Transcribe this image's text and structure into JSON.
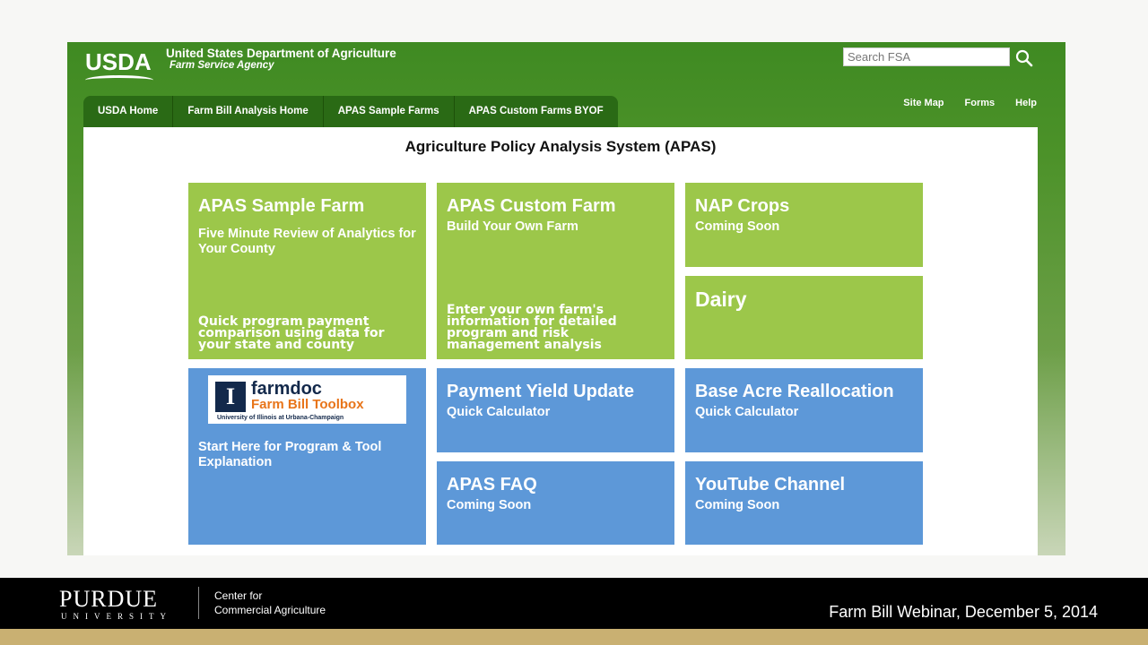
{
  "usda": {
    "logo": "USDA",
    "department": "United States Department of Agriculture",
    "agency": "Farm Service Agency",
    "search_placeholder": "Search FSA"
  },
  "nav": [
    "USDA Home",
    "Farm Bill Analysis Home",
    "APAS Sample Farms",
    "APAS Custom Farms BYOF"
  ],
  "util_links": [
    "Site Map",
    "Forms",
    "Help"
  ],
  "page_title": "Agriculture Policy Analysis System (APAS)",
  "tiles": {
    "sample_farm": {
      "title": "APAS Sample Farm",
      "subtitle": "Five Minute Review of Analytics for Your County",
      "description": "Quick program payment comparison using data for your state and county"
    },
    "custom_farm": {
      "title": "APAS Custom Farm",
      "subtitle": "Build Your Own Farm",
      "description": "Enter your own farm's information for detailed program and risk management analysis"
    },
    "nap_crops": {
      "title": "NAP Crops",
      "subtitle": "Coming Soon"
    },
    "dairy": {
      "title": "Dairy"
    },
    "farmdoc": {
      "logo_word": "farmdoc",
      "logo_tool": "Farm Bill Toolbox",
      "logo_university": "University of Illinois at Urbana-Champaign",
      "text": "Start Here for Program & Tool Explanation"
    },
    "payment_yield": {
      "title": "Payment Yield Update",
      "subtitle": "Quick Calculator"
    },
    "base_acre": {
      "title": "Base Acre Reallocation",
      "subtitle": "Quick Calculator"
    },
    "faq": {
      "title": "APAS FAQ",
      "subtitle": "Coming Soon"
    },
    "youtube": {
      "title": "YouTube Channel",
      "subtitle": "Coming Soon"
    }
  },
  "footer": {
    "purdue": "PURDUE",
    "university": "UNIVERSITY",
    "center_line1": "Center for",
    "center_line2": "Commercial Agriculture",
    "webinar": "Farm Bill Webinar, December 5, 2014"
  }
}
